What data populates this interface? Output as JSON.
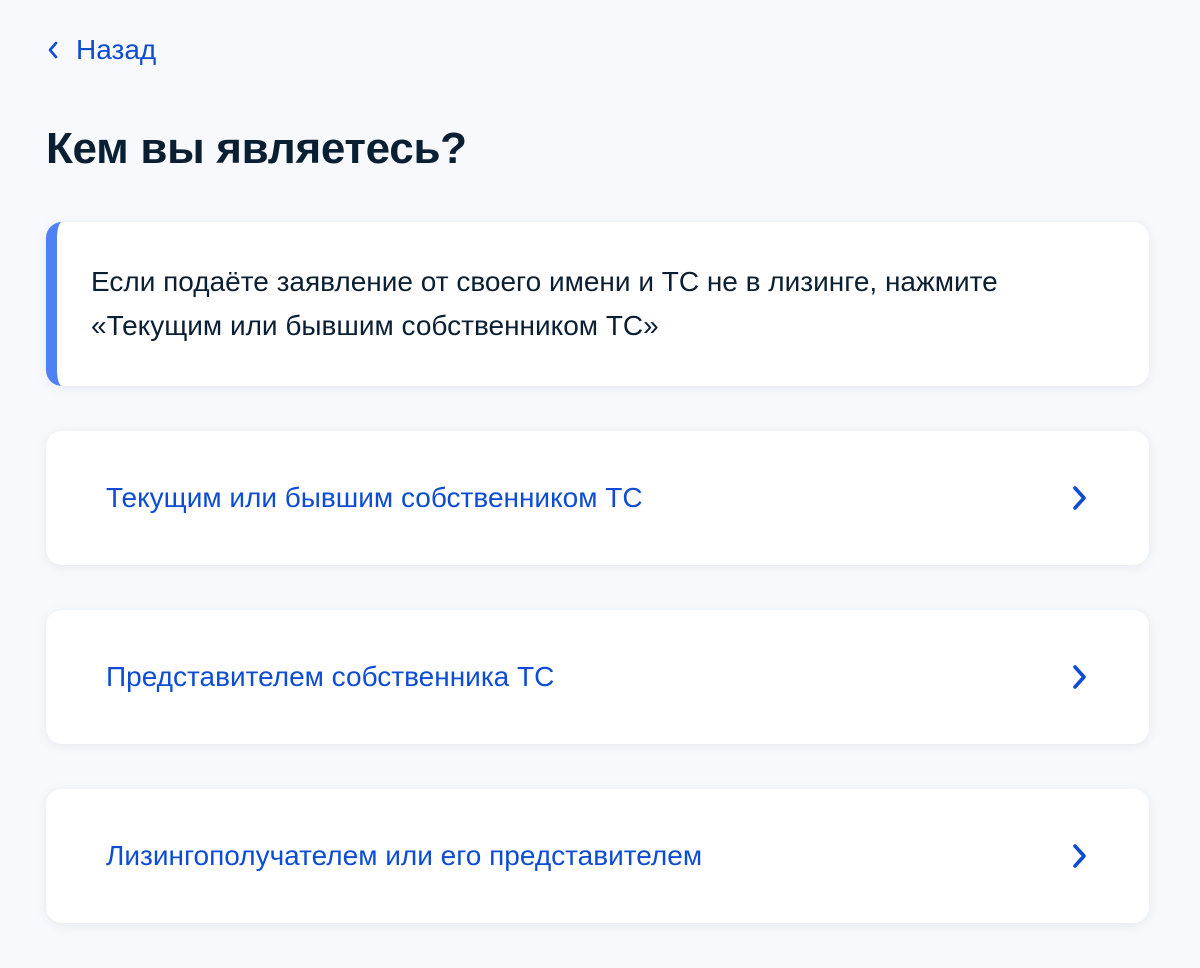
{
  "back": {
    "label": "Назад"
  },
  "title": "Кем вы являетесь?",
  "info": {
    "text_line1": "Если подаёте заявление от своего имени и ТС не в лизинге, нажмите",
    "text_line2": "«Текущим или бывшим собственником ТС»"
  },
  "options": [
    {
      "label": "Текущим или бывшим собственником ТС"
    },
    {
      "label": "Представителем собственника ТС"
    },
    {
      "label": "Лизингополучателем или его представителем"
    }
  ],
  "colors": {
    "accent": "#0d4cd3",
    "info_bar": "#4f81f5",
    "background": "#f7f9fc",
    "text": "#0b1f33"
  },
  "icons": {
    "back": "chevron-left-icon",
    "option": "chevron-right-icon"
  }
}
